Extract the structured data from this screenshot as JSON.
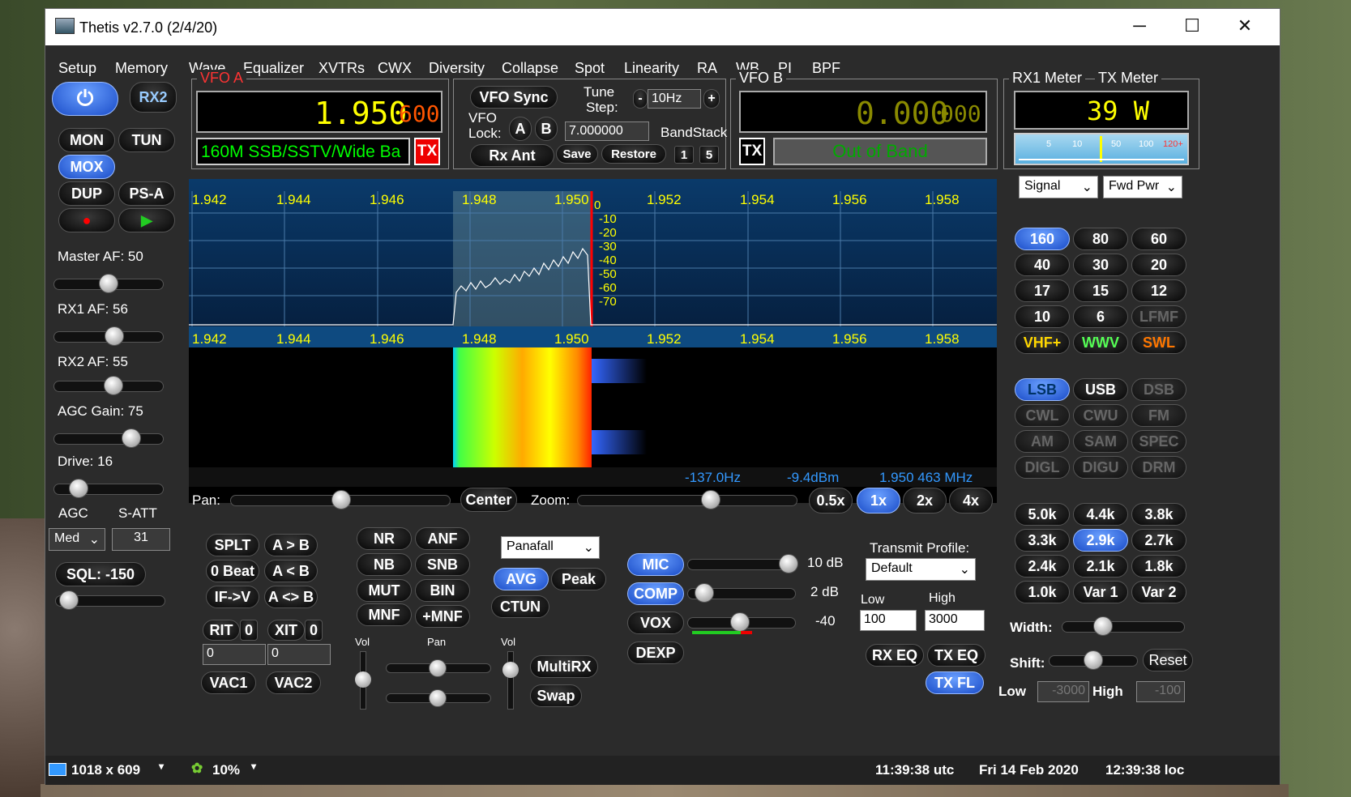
{
  "window": {
    "title": "Thetis v2.7.0 (2/4/20)",
    "min": "─",
    "max": "☐",
    "close": "✕"
  },
  "menu": [
    "Setup",
    "Memory",
    "Wave",
    "Equalizer",
    "XVTRs",
    "CWX",
    "Diversity",
    "Collapse",
    "Spot",
    "Linearity",
    "RA",
    "WB",
    "PI",
    "BPF"
  ],
  "left": {
    "power": "⏻",
    "rx2": "RX2",
    "mon": "MON",
    "tun": "TUN",
    "mox": "MOX",
    "dup": "DUP",
    "psa": "PS-A",
    "rec": "●",
    "play": "▶",
    "master_af": "Master AF:  50",
    "rx1_af": "RX1 AF:  56",
    "rx2_af": "RX2 AF:  55",
    "agc_gain": "AGC Gain:  75",
    "drive": "Drive:  16",
    "agc": "AGC",
    "satt": "S-ATT",
    "agc_val": "Med",
    "satt_val": "31",
    "sql": "SQL:  -150",
    "master_level": 0.5,
    "rx1_level": 0.56,
    "rx2_level": 0.55,
    "agc_level": 0.75,
    "drive_level": 0.16
  },
  "vfoa": {
    "title": "VFO A",
    "freq": "1.950",
    "sub": "600",
    "band": "160M SSB/SSTV/Wide Ba",
    "tx": "TX"
  },
  "vfomid": {
    "sync": "VFO Sync",
    "tune": "Tune",
    "step": "Step:",
    "minus": "-",
    "stepval": "10Hz",
    "plus": "+",
    "vfo": "VFO",
    "lock": "Lock:",
    "a": "A",
    "b": "B",
    "stack_val": "7.000000",
    "bandstack": "BandStack",
    "rxant": "Rx Ant",
    "save": "Save",
    "restore": "Restore",
    "n1": "1",
    "n5": "5"
  },
  "vfob": {
    "title": "VFO B",
    "freq": "0.000",
    "sub": "000",
    "tx": "TX",
    "band": "Out of Band"
  },
  "meter": {
    "rx1": "RX1 Meter",
    "tx": "TX Meter",
    "value": "39 W",
    "scale": [
      "5",
      "10",
      "50",
      "100",
      "120+"
    ],
    "sel1": "Signal",
    "sel2": "Fwd Pwr"
  },
  "panadapter": {
    "freqs": [
      "1.942",
      "1.944",
      "1.946",
      "1.948",
      "1.950",
      "1.952",
      "1.954",
      "1.956",
      "1.958"
    ],
    "db": [
      "0",
      "-10",
      "-20",
      "-30",
      "-40",
      "-50",
      "-60",
      "-70"
    ],
    "readout_hz": "-137.0Hz",
    "readout_dbm": "-9.4dBm",
    "readout_mhz": "1.950 463 MHz"
  },
  "panzoom": {
    "pan": "Pan:",
    "center": "Center",
    "zoom": "Zoom:",
    "z05": "0.5x",
    "z1": "1x",
    "z2": "2x",
    "z4": "4x"
  },
  "bands": [
    "160",
    "80",
    "60",
    "40",
    "30",
    "20",
    "17",
    "15",
    "12",
    "10",
    "6",
    "LFMF",
    "VHF+",
    "WWV",
    "SWL"
  ],
  "modes": [
    "LSB",
    "USB",
    "DSB",
    "CWL",
    "CWU",
    "FM",
    "AM",
    "SAM",
    "SPEC",
    "DIGL",
    "DIGU",
    "DRM"
  ],
  "filters": [
    "5.0k",
    "4.4k",
    "3.8k",
    "3.3k",
    "2.9k",
    "2.7k",
    "2.4k",
    "2.1k",
    "1.8k",
    "1.0k",
    "Var 1",
    "Var 2"
  ],
  "filterctl": {
    "width": "Width:",
    "shift": "Shift:",
    "reset": "Reset",
    "low": "Low",
    "low_val": "-3000",
    "high": "High",
    "high_val": "-100"
  },
  "bottomleft": {
    "splt": "SPLT",
    "atob": "A > B",
    "zbeat": "0 Beat",
    "btoa": "A < B",
    "ifv": "IF->V",
    "swap": "A <> B",
    "rit": "RIT",
    "rit_val": "0",
    "xit": "XIT",
    "xit_val": "0",
    "rit_in": "0",
    "xit_in": "0",
    "vac1": "VAC1",
    "vac2": "VAC2"
  },
  "dsp": {
    "nr": "NR",
    "anf": "ANF",
    "nb": "NB",
    "snb": "SNB",
    "mut": "MUT",
    "bin": "BIN",
    "mnf": "MNF",
    "pmnf": "+MNF",
    "vol": "Vol",
    "pan": "Pan",
    "vol2": "Vol",
    "multirx": "MultiRX",
    "swap": "Swap"
  },
  "display": {
    "mode": "Panafall",
    "avg": "AVG",
    "peak": "Peak",
    "ctun": "CTUN"
  },
  "tx": {
    "mic": "MIC",
    "mic_val": "10 dB",
    "comp": "COMP",
    "comp_val": "2 dB",
    "vox": "VOX",
    "vox_val": "-40",
    "dexp": "DEXP",
    "profile_lbl": "Transmit Profile:",
    "profile": "Default",
    "low": "Low",
    "high": "High",
    "low_val": "100",
    "high_val": "3000",
    "rxeq": "RX EQ",
    "txeq": "TX EQ",
    "txfl": "TX FL"
  },
  "status": {
    "res": "1018 x 609",
    "cpu": "10%",
    "utc": "11:39:38 utc",
    "date": "Fri 14 Feb 2020",
    "loc": "12:39:38 loc"
  }
}
